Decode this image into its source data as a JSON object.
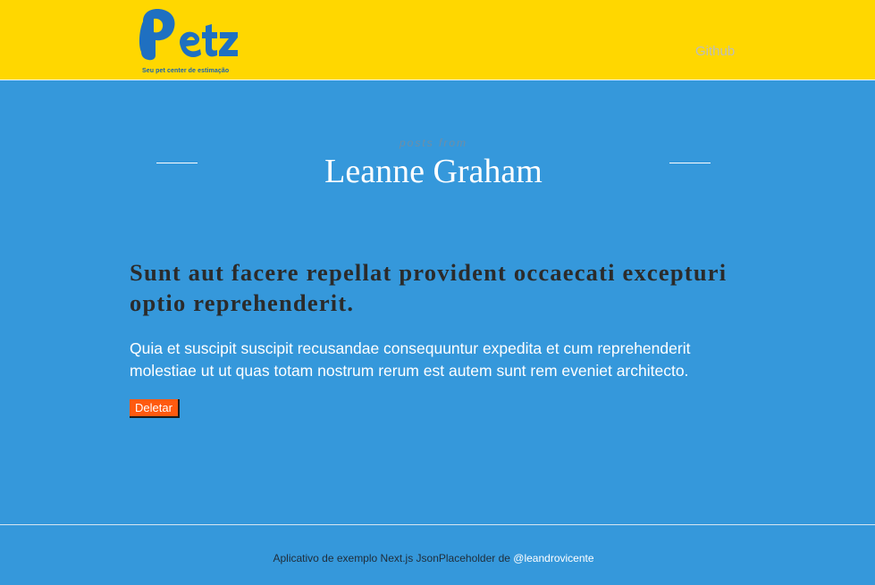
{
  "header": {
    "logo_text": "Petz",
    "logo_tagline": "Seu pet center de estimação",
    "github_label": "Github"
  },
  "hero": {
    "subtitle": "posts from",
    "title": "Leanne Graham"
  },
  "post": {
    "title": "Sunt aut facere repellat provident occaecati excepturi optio reprehenderit.",
    "body": "Quia et suscipit suscipit recusandae consequuntur expedita et cum reprehenderit molestiae ut ut quas totam nostrum rerum est autem sunt rem eveniet architecto.",
    "delete_label": "Deletar"
  },
  "footer": {
    "text": "Aplicativo de exemplo Next.js JsonPlaceholder de ",
    "link_label": "@leandrovicente"
  },
  "colors": {
    "header_bg": "#ffd700",
    "page_bg": "#3598db",
    "logo_blue": "#1f70c1",
    "delete_button": "#ff5a0f"
  }
}
